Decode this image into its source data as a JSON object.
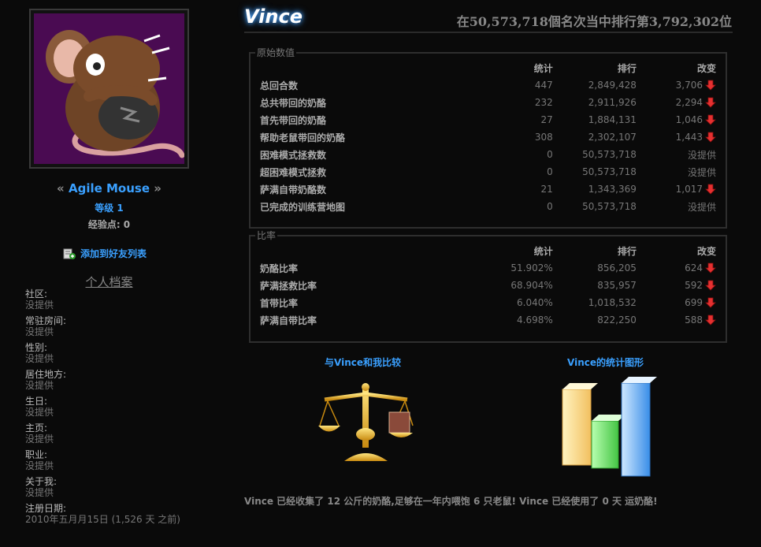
{
  "player": {
    "name": "Vince",
    "rank_text": "在50,573,718個名次当中排行第3,792,302位"
  },
  "sidebar": {
    "title_quote_left": "«",
    "title": "Agile Mouse",
    "title_quote_right": "»",
    "level": "等级 1",
    "points": "经验点: 0",
    "add_friend": "添加到好友列表",
    "profile_heading": "个人档案",
    "fields": [
      {
        "key": "社区:",
        "value": "没提供"
      },
      {
        "key": "常驻房间:",
        "value": "没提供"
      },
      {
        "key": "性别:",
        "value": "没提供"
      },
      {
        "key": "居住地方:",
        "value": "没提供"
      },
      {
        "key": "生日:",
        "value": "没提供"
      },
      {
        "key": "主页:",
        "value": "没提供"
      },
      {
        "key": "职业:",
        "value": "没提供"
      },
      {
        "key": "关于我:",
        "value": "没提供"
      },
      {
        "key": "注册日期:",
        "value": "2010年五月月15日 (1,526 天 之前)"
      }
    ]
  },
  "raw_stats": {
    "legend": "原始数值",
    "headers": [
      "统计",
      "排行",
      "改变"
    ],
    "rows": [
      {
        "label": "总回合数",
        "stat": "447",
        "rank": "2,849,428",
        "change": "3,706",
        "arrow": true
      },
      {
        "label": "总共带回的奶酪",
        "stat": "232",
        "rank": "2,911,926",
        "change": "2,294",
        "arrow": true
      },
      {
        "label": "首先带回的奶酪",
        "stat": "27",
        "rank": "1,884,131",
        "change": "1,046",
        "arrow": true
      },
      {
        "label": "帮助老鼠带回的奶酪",
        "stat": "308",
        "rank": "2,302,107",
        "change": "1,443",
        "arrow": true
      },
      {
        "label": "困难模式拯救数",
        "stat": "0",
        "rank": "50,573,718",
        "change": "没提供",
        "arrow": false
      },
      {
        "label": "超困难模式拯救",
        "stat": "0",
        "rank": "50,573,718",
        "change": "没提供",
        "arrow": false
      },
      {
        "label": "萨满自带奶酪数",
        "stat": "21",
        "rank": "1,343,369",
        "change": "1,017",
        "arrow": true
      },
      {
        "label": "已完成的训练营地图",
        "stat": "0",
        "rank": "50,573,718",
        "change": "没提供",
        "arrow": false
      }
    ]
  },
  "ratio_stats": {
    "legend": "比率",
    "headers": [
      "统计",
      "排行",
      "改变"
    ],
    "rows": [
      {
        "label": "奶酪比率",
        "stat": "51.902%",
        "rank": "856,205",
        "change": "624",
        "arrow": true
      },
      {
        "label": "萨满拯救比率",
        "stat": "68.904%",
        "rank": "835,957",
        "change": "592",
        "arrow": true
      },
      {
        "label": "首带比率",
        "stat": "6.040%",
        "rank": "1,018,532",
        "change": "699",
        "arrow": true
      },
      {
        "label": "萨满自带比率",
        "stat": "4.698%",
        "rank": "822,250",
        "change": "588",
        "arrow": true
      }
    ]
  },
  "links": {
    "compare": "与Vince和我比较",
    "graphs": "Vince的统计图形"
  },
  "summary": "Vince 已经收集了 12 公斤的奶酪,足够在一年内喂饱 6 只老鼠! Vince 已经使用了 0 天 运奶酪!",
  "colors": {
    "accent": "#3aa0ff",
    "down_arrow": "#e53030",
    "avatar_bg": "#4a0b52"
  },
  "icons": [
    "mouse-avatar",
    "add-friend-icon",
    "down-arrow-icon",
    "balance-scale-icon",
    "bar-graph-icon"
  ]
}
